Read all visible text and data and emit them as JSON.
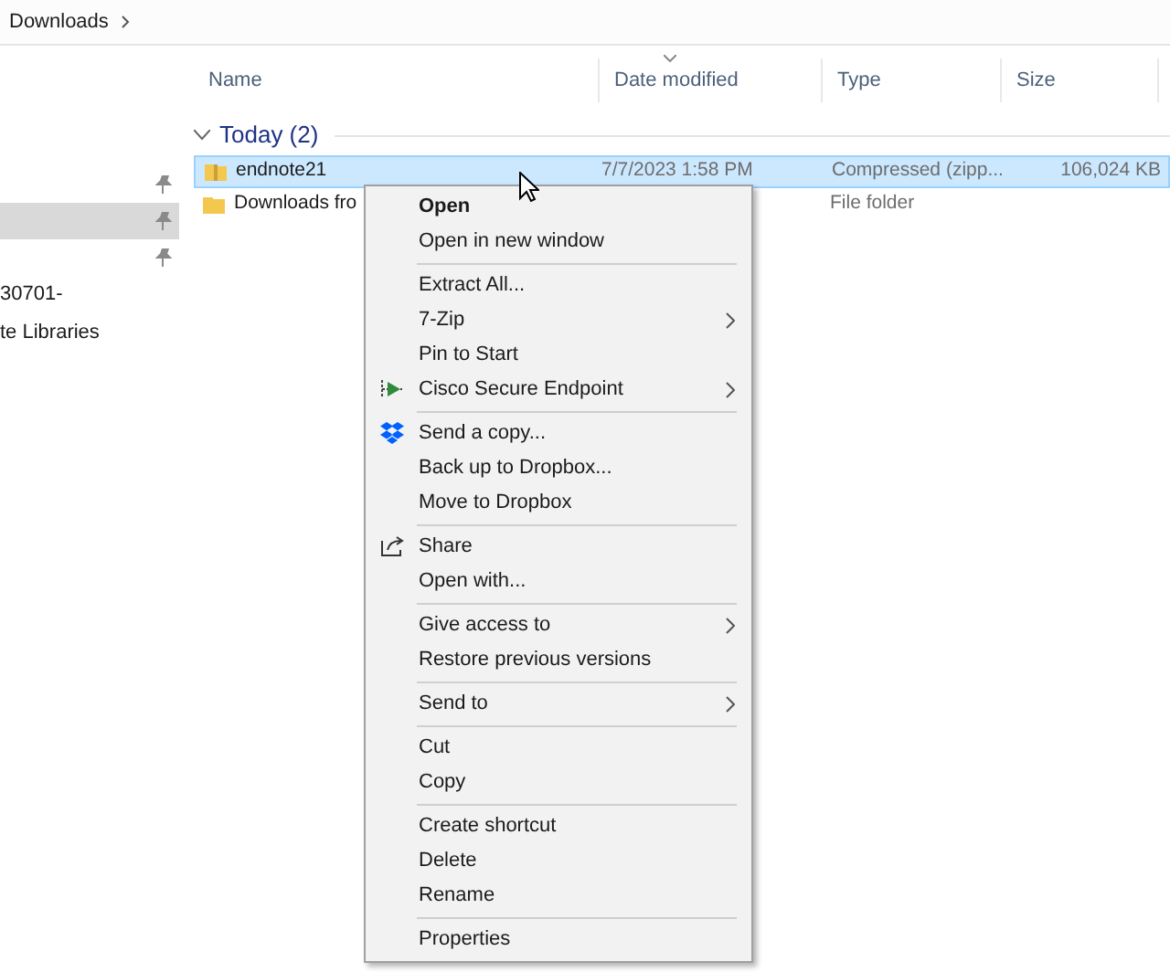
{
  "breadcrumb": {
    "location": "Downloads"
  },
  "sidebar": {
    "items": [
      {
        "pinned": true,
        "selected": false
      },
      {
        "pinned": true,
        "selected": true
      },
      {
        "pinned": true,
        "selected": false
      },
      {
        "label": "30701-",
        "pinned": false,
        "selected": false
      },
      {
        "label": "te Libraries",
        "pinned": false,
        "selected": false
      }
    ]
  },
  "columns": [
    {
      "label": "Name",
      "sorted": false
    },
    {
      "label": "Date modified",
      "sorted": true
    },
    {
      "label": "Type",
      "sorted": false
    },
    {
      "label": "Size",
      "sorted": false
    }
  ],
  "group": {
    "label": "Today (2)",
    "expanded": true
  },
  "files": [
    {
      "name": "endnote21",
      "date": "7/7/2023 1:58 PM",
      "type": "Compressed (zipp...",
      "size": "106,024 KB",
      "selected": true
    },
    {
      "name": "Downloads fro",
      "type": "File folder",
      "selected": false
    }
  ],
  "context_menu": {
    "items": [
      {
        "kind": "item",
        "label": "Open",
        "default": true
      },
      {
        "kind": "item",
        "label": "Open in new window"
      },
      {
        "kind": "separator"
      },
      {
        "kind": "item",
        "label": "Extract All..."
      },
      {
        "kind": "item",
        "label": "7-Zip",
        "submenu": true
      },
      {
        "kind": "item",
        "label": "Pin to Start"
      },
      {
        "kind": "item",
        "label": "Cisco Secure Endpoint",
        "submenu": true
      },
      {
        "kind": "separator"
      },
      {
        "kind": "item",
        "label": "Send a copy..."
      },
      {
        "kind": "item",
        "label": "Back up to Dropbox..."
      },
      {
        "kind": "item",
        "label": "Move to Dropbox"
      },
      {
        "kind": "separator"
      },
      {
        "kind": "item",
        "label": "Share"
      },
      {
        "kind": "item",
        "label": "Open with..."
      },
      {
        "kind": "separator"
      },
      {
        "kind": "item",
        "label": "Give access to",
        "submenu": true
      },
      {
        "kind": "item",
        "label": "Restore previous versions"
      },
      {
        "kind": "separator"
      },
      {
        "kind": "item",
        "label": "Send to",
        "submenu": true
      },
      {
        "kind": "separator"
      },
      {
        "kind": "item",
        "label": "Cut"
      },
      {
        "kind": "item",
        "label": "Copy"
      },
      {
        "kind": "separator"
      },
      {
        "kind": "item",
        "label": "Create shortcut"
      },
      {
        "kind": "item",
        "label": "Delete"
      },
      {
        "kind": "item",
        "label": "Rename"
      },
      {
        "kind": "separator"
      },
      {
        "kind": "item",
        "label": "Properties"
      }
    ]
  }
}
